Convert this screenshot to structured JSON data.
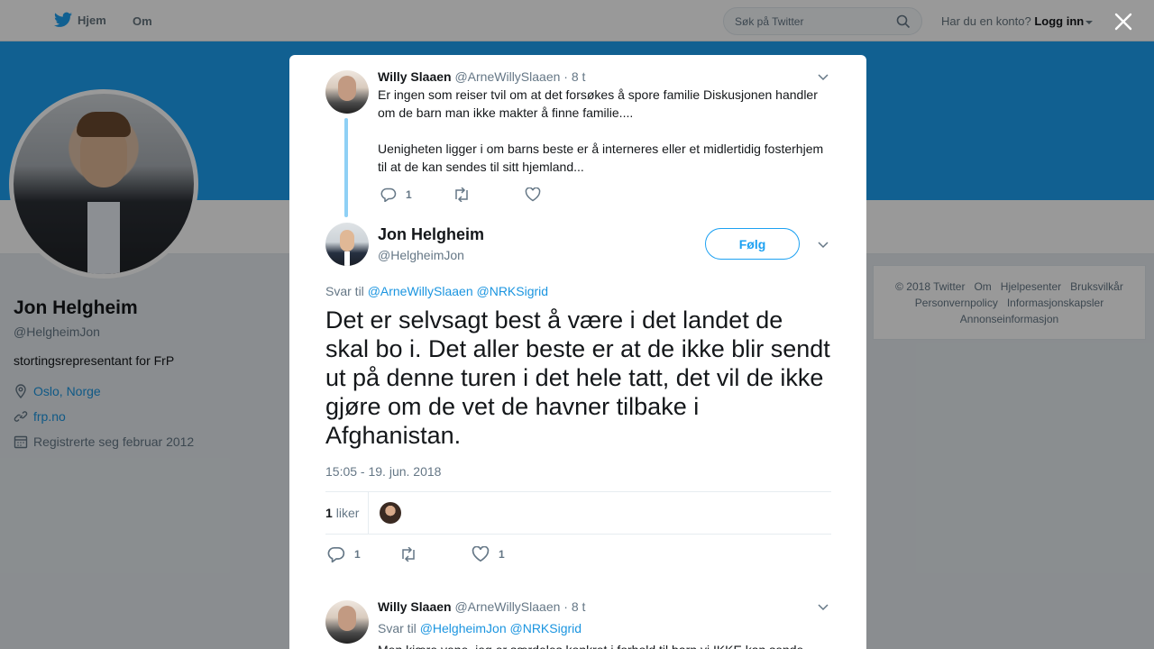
{
  "topbar": {
    "home_label": "Hjem",
    "about_label": "Om",
    "search_placeholder": "Søk på Twitter",
    "account_prompt": "Har du en konto?",
    "login_label": "Logg inn"
  },
  "profile": {
    "name": "Jon Helgheim",
    "handle": "@HelgheimJon",
    "bio": "stortingsrepresentant for FrP",
    "location": "Oslo, Norge",
    "website": "frp.no",
    "joined": "Registrerte seg februar 2012"
  },
  "footer": {
    "links": [
      "© 2018 Twitter",
      "Om",
      "Hjelpesenter",
      "Bruksvilkår",
      "Personvernpolicy",
      "Informasjonskapsler",
      "Annonseinformasjon"
    ]
  },
  "parent_tweet": {
    "name": "Willy Slaaen",
    "handle": "@ArneWillySlaaen",
    "time": "· 8 t",
    "text1": "Er ingen som reiser tvil om at det forsøkes å spore familie Diskusjonen handler om de barn man ikke makter å finne familie....",
    "text2": "Uenigheten ligger i om barns beste er å interneres eller et midlertidig fosterhjem til at de kan sendes til sitt hjemland...",
    "reply_count": "1"
  },
  "main_tweet": {
    "name": "Jon Helgheim",
    "handle": "@HelgheimJon",
    "follow_label": "Følg",
    "reply_prefix": "Svar til",
    "reply_to_1": "@ArneWillySlaaen",
    "reply_to_2": "@NRKSigrid",
    "text": "Det er selvsagt best å være i det landet de skal bo i. Det aller beste er at de ikke blir sendt ut på denne turen i det hele tatt, det vil de ikke gjøre om de vet de havner tilbake i Afghanistan.",
    "timestamp": "15:05 - 19. jun. 2018",
    "likes_count": "1",
    "likes_label": "liker",
    "reply_count": "1",
    "like_count": "1"
  },
  "next_tweet": {
    "name": "Willy Slaaen",
    "handle": "@ArneWillySlaaen",
    "time": "· 8 t",
    "reply_prefix": "Svar til",
    "reply_to_1": "@HelgheimJon",
    "reply_to_2": "@NRKSigrid",
    "text": "Men kjære vene, jeg er særdeles konkret i forhold til barn vi IKKE kan sende"
  }
}
